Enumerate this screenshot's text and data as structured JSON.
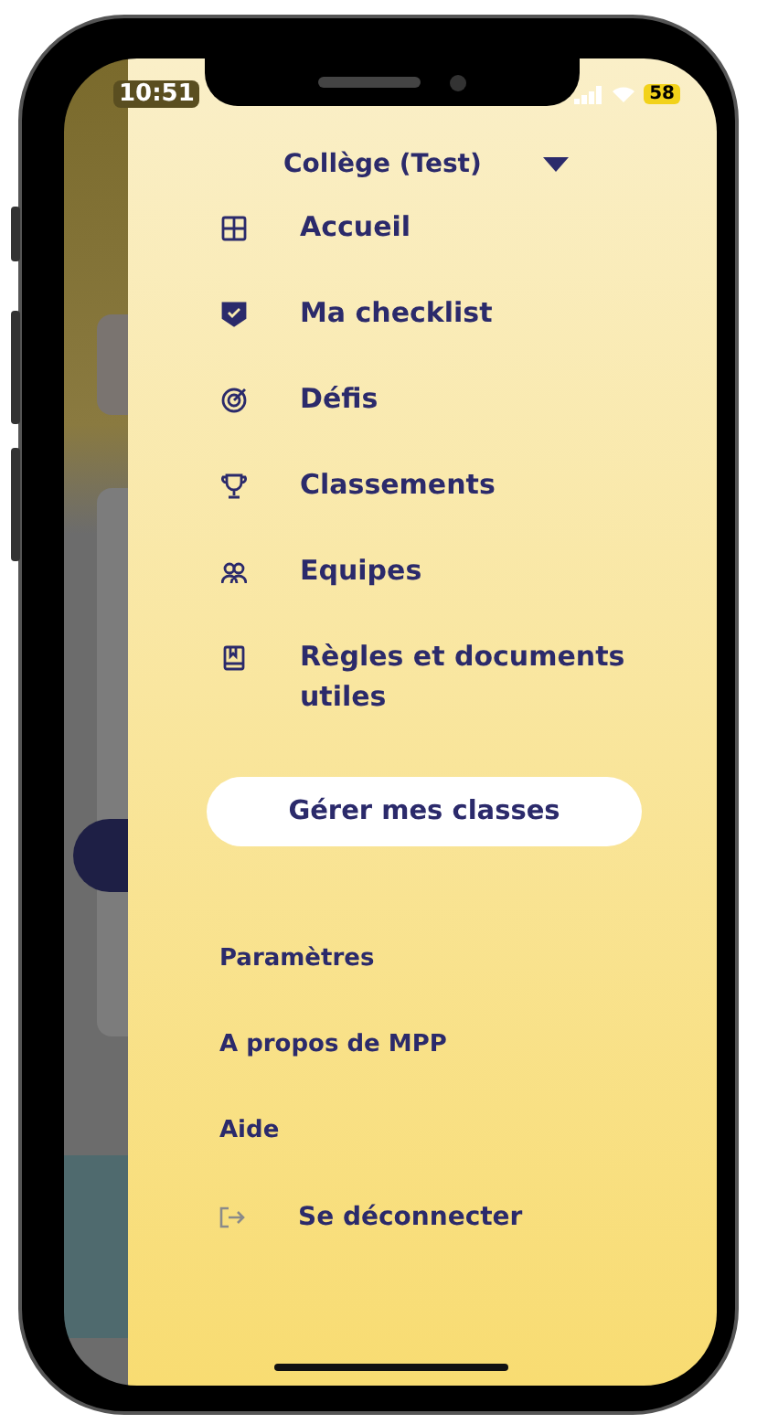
{
  "status_bar": {
    "time": "10:51",
    "battery": "58"
  },
  "drawer": {
    "school_selector": {
      "label": "Collège (Test)"
    },
    "menu": [
      {
        "label": "Accueil"
      },
      {
        "label": "Ma checklist"
      },
      {
        "label": "Défis"
      },
      {
        "label": "Classements"
      },
      {
        "label": "Equipes"
      },
      {
        "label": "Règles et documents utiles"
      }
    ],
    "button": "Gérer mes classes",
    "links": [
      {
        "label": "Paramètres",
        "kind": "plain"
      },
      {
        "label": "A propos de MPP",
        "kind": "plain"
      },
      {
        "label": "Aide",
        "kind": "plain"
      },
      {
        "label": "Se déconnecter",
        "kind": "logout"
      }
    ]
  }
}
